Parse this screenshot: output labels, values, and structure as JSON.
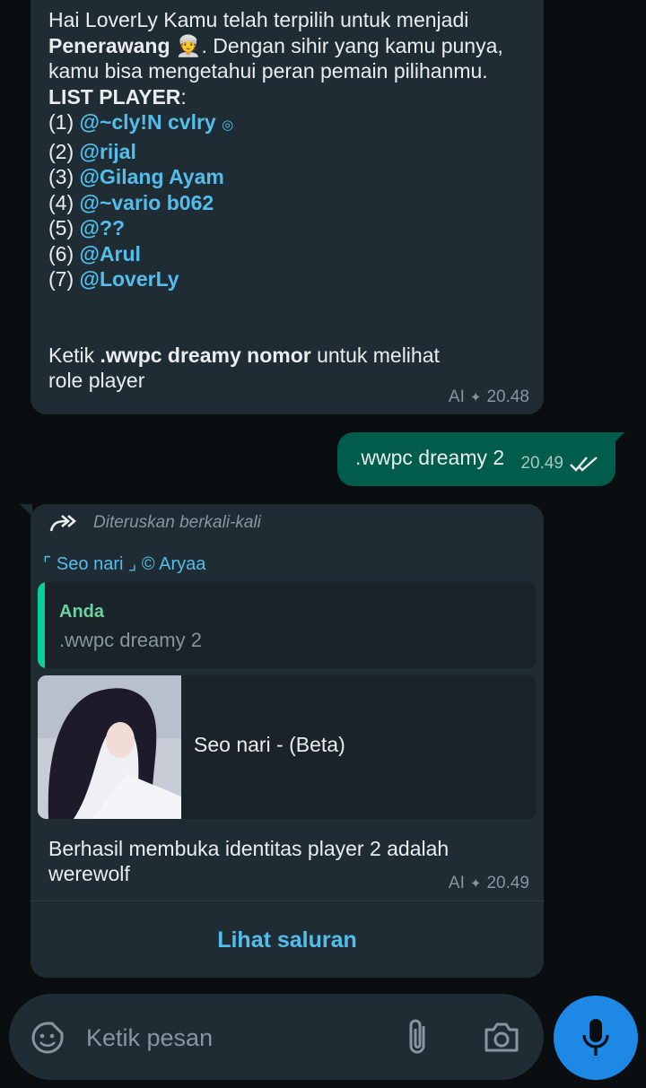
{
  "message1": {
    "line1": "Hai LoverLy Kamu telah terpilih  untuk menjadi",
    "role_name": "Penerawang",
    "role_emoji": "👳",
    "line2_rest": ". Dengan sihir yang kamu punya,",
    "line3": "kamu bisa mengetahui peran pemain pilihanmu.",
    "list_header": "LIST PLAYER",
    "list_colon": ":",
    "players": [
      {
        "num": "(1)",
        "name": "@~cly!N cvlry",
        "suffix": "◎"
      },
      {
        "num": "(2)",
        "name": "@rijal",
        "suffix": ""
      },
      {
        "num": "(3)",
        "name": "@Gilang Ayam",
        "suffix": ""
      },
      {
        "num": "(4)",
        "name": "@~vario b062",
        "suffix": ""
      },
      {
        "num": "(5)",
        "name": "@??",
        "suffix": ""
      },
      {
        "num": "(6)",
        "name": "@Arul",
        "suffix": ""
      },
      {
        "num": "(7)",
        "name": "@LoverLy",
        "suffix": ""
      }
    ],
    "instr_pre": "Ketik ",
    "instr_cmd": ".wwpc dreamy nomor",
    "instr_post": " untuk melihat role player",
    "ai_label": "AI",
    "ai_glyph": "✦",
    "time": "20.48"
  },
  "outgoing": {
    "text": ".wwpc dreamy 2",
    "time": "20.49",
    "status_icon": "double-check-icon"
  },
  "message2": {
    "forwarded_label": "Diteruskan berkali-kali",
    "channel_name": "⌜ Seo nari ⌟ © Aryaa",
    "quote_author": "Anda",
    "quote_text": ".wwpc dreamy 2",
    "card_title": "Seo nari - (Beta)",
    "reply_text": "Berhasil membuka identitas player 2 adalah werewolf",
    "ai_label": "AI",
    "ai_glyph": "✦",
    "time": "20.49",
    "view_channel_label": "Lihat saluran"
  },
  "input": {
    "placeholder": "Ketik pesan"
  },
  "colors": {
    "background": "#0b0e10",
    "incoming_bubble": "#202c33",
    "outgoing_bubble": "#005c4b",
    "mention": "#53bdeb",
    "quote_bar": "#06cf9c",
    "mic_button": "#1e88e5"
  }
}
